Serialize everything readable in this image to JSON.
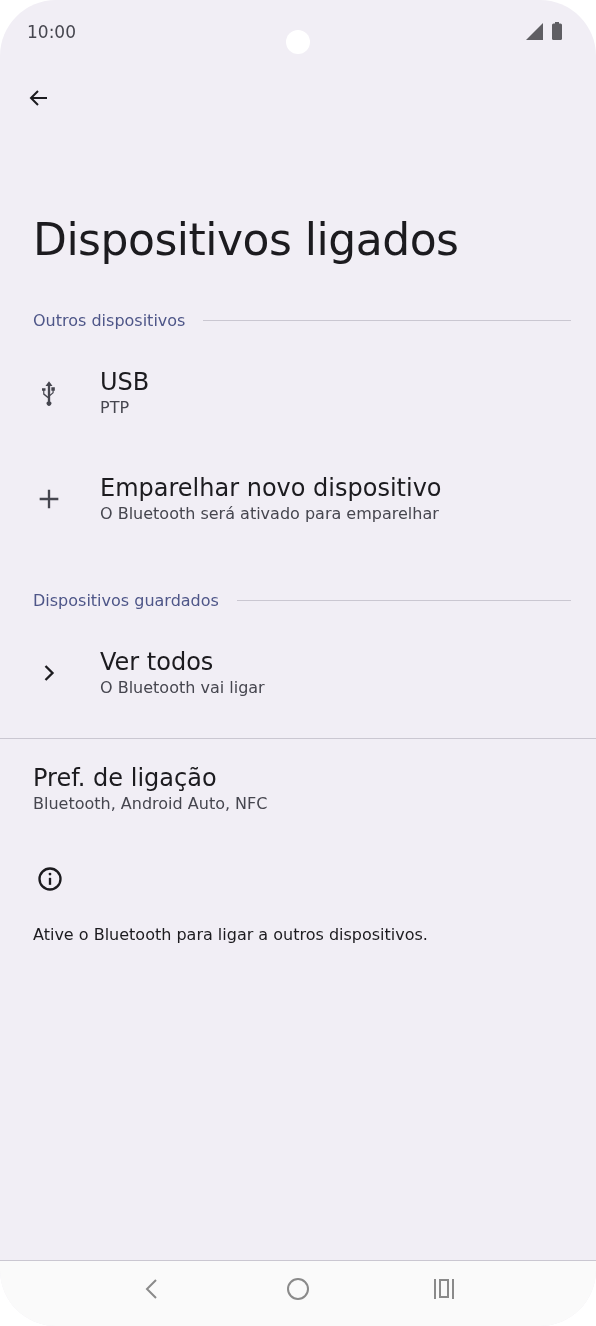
{
  "status_bar": {
    "time": "10:00"
  },
  "title": "Dispositivos ligados",
  "sections": [
    {
      "header": "Outros dispositivos",
      "items": [
        {
          "kind": "usb",
          "title": "USB",
          "subtitle": "PTP"
        },
        {
          "kind": "add",
          "title": "Emparelhar novo dispositivo",
          "subtitle": "O Bluetooth será ativado para emparelhar"
        }
      ]
    },
    {
      "header": "Dispositivos guardados",
      "items": [
        {
          "kind": "chevron",
          "title": "Ver todos",
          "subtitle": "O Bluetooth vai ligar"
        }
      ]
    }
  ],
  "preferences": {
    "title": "Pref. de ligação",
    "subtitle": "Bluetooth, Android Auto, NFC"
  },
  "info": {
    "text": "Ative o Bluetooth para ligar a outros dispositivos."
  }
}
